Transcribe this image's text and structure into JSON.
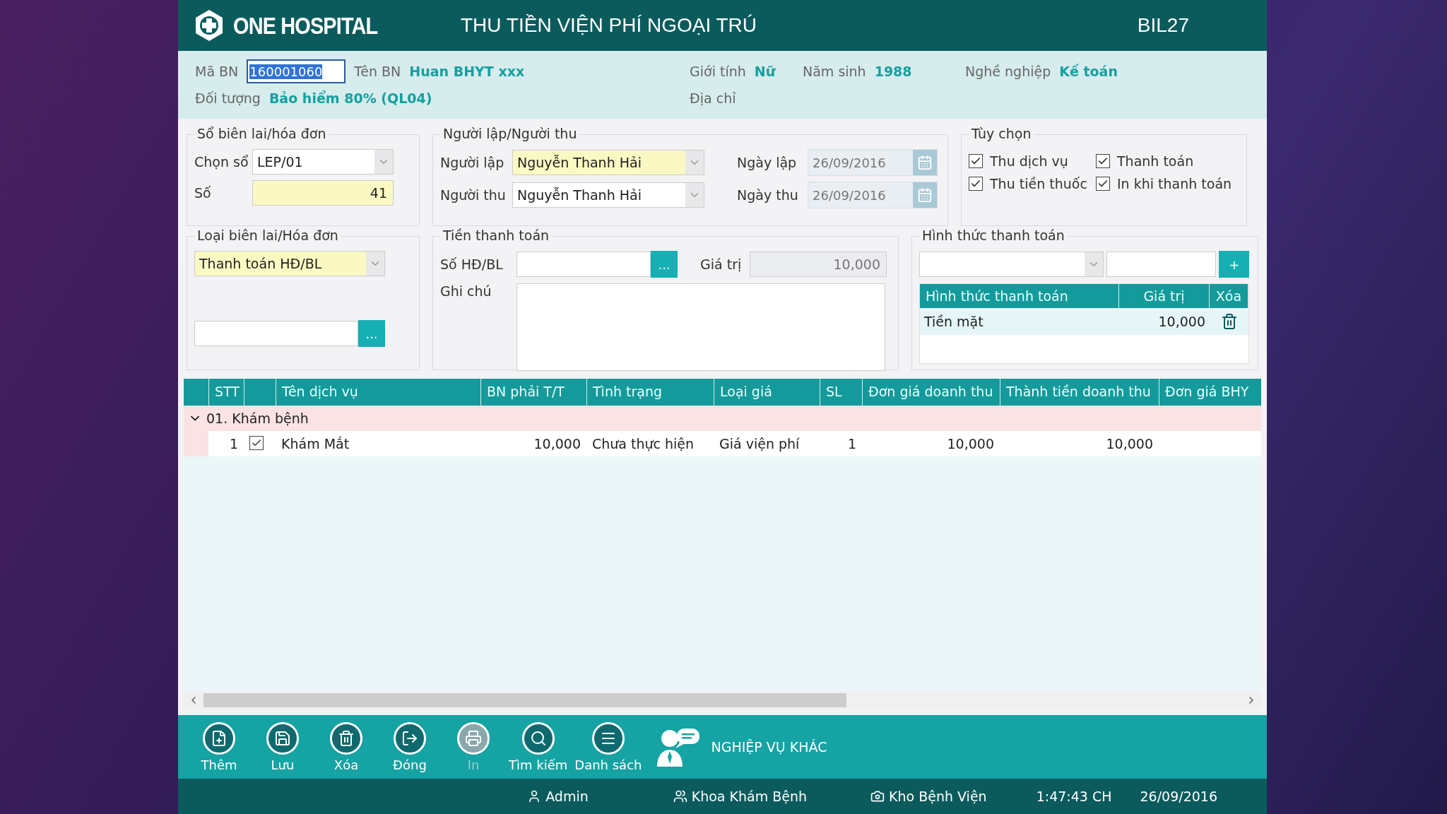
{
  "header": {
    "logo_text": "ONE HOSPITAL",
    "title": "THU TIỀN VIỆN PHÍ NGOẠI TRÚ",
    "code": "BIL27"
  },
  "patient": {
    "ma_bn": {
      "label": "Mã BN",
      "value": "160001060",
      "text_selected": true
    },
    "ten_bn": {
      "label": "Tên BN",
      "value": "Huan BHYT xxx"
    },
    "gioi_tinh": {
      "label": "Giới tính",
      "value": "Nữ"
    },
    "nam_sinh": {
      "label": "Năm sinh",
      "value": "1988"
    },
    "nghe_nghiep": {
      "label": "Nghề nghiệp",
      "value": "Kế toán"
    },
    "doi_tuong": {
      "label": "Đối tượng",
      "value": "Bảo hiểm 80% (QL04)"
    },
    "dia_chi": {
      "label": "Địa chỉ"
    }
  },
  "so_bien_lai": {
    "title": "Sổ biên lai/hóa đơn",
    "chon_so": {
      "label": "Chọn sổ",
      "value": "LEP/01"
    },
    "so": {
      "label": "Số",
      "value": "41"
    }
  },
  "nguoi_lap_thu": {
    "title": "Người lập/Người thu",
    "nguoi_lap": {
      "label": "Người lập",
      "value": "Nguyễn Thanh Hải"
    },
    "nguoi_thu": {
      "label": "Người thu",
      "value": "Nguyễn Thanh Hải"
    },
    "ngay_lap": {
      "label": "Ngày lập",
      "value": "26/09/2016"
    },
    "ngay_thu": {
      "label": "Ngày thu",
      "value": "26/09/2016"
    }
  },
  "tuy_chon": {
    "title": "Tùy chọn",
    "options": [
      {
        "label": "Thu dịch vụ",
        "checked": true
      },
      {
        "label": "Thanh toán",
        "checked": true
      },
      {
        "label": "Thu tiền thuốc",
        "checked": true
      },
      {
        "label": "In khi thanh toán",
        "checked": true
      }
    ]
  },
  "loai_bien_lai": {
    "title": "Loại biên lai/Hóa đơn",
    "value": "Thanh toán HĐ/BL",
    "browse_button": "..."
  },
  "tien_thanh_toan": {
    "title": "Tiền thanh toán",
    "so_hd": {
      "label": "Số HĐ/BL",
      "browse_button": "..."
    },
    "gia_tri": {
      "label": "Giá trị",
      "value": "10,000"
    },
    "ghi_chu": {
      "label": "Ghi chú"
    }
  },
  "hinh_thuc": {
    "title": "Hình thức thanh toán",
    "add_button": "+",
    "columns": [
      "Hình thức thanh toán",
      "Giá trị",
      "Xóa"
    ],
    "rows": [
      {
        "method": "Tiền mặt",
        "value": "10,000"
      }
    ]
  },
  "services": {
    "columns": [
      "STT",
      "",
      "Tên dịch vụ",
      "BN phải T/T",
      "Tình trạng",
      "Loại giá",
      "SL",
      "Đơn giá doanh thu",
      "Thành tiền doanh thu",
      "Đơn giá BHY"
    ],
    "groups": [
      {
        "label": "01. Khám bệnh",
        "expanded": true,
        "rows": [
          {
            "stt": "1",
            "checked": true,
            "name": "Khám Mắt",
            "bn_phai_tt": "10,000",
            "tinh_trang": "Chưa thực hiện",
            "loai_gia": "Giá viện phí",
            "sl": "1",
            "don_gia": "10,000",
            "thanh_tien": "10,000"
          }
        ]
      }
    ]
  },
  "toolbar": {
    "buttons": [
      {
        "kind": "add",
        "label": "Thêm",
        "disabled": false
      },
      {
        "kind": "save",
        "label": "Lưu",
        "disabled": false
      },
      {
        "kind": "delete",
        "label": "Xóa",
        "disabled": false
      },
      {
        "kind": "close",
        "label": "Đóng",
        "disabled": false
      },
      {
        "kind": "print",
        "label": "In",
        "disabled": true
      },
      {
        "kind": "search",
        "label": "Tìm kiếm",
        "disabled": false
      },
      {
        "kind": "list",
        "label": "Danh sách",
        "disabled": false
      }
    ],
    "other": "NGHIỆP VỤ KHÁC"
  },
  "status_bar": [
    {
      "kind": "user",
      "text": "Admin"
    },
    {
      "kind": "department",
      "text": "Khoa Khám Bệnh"
    },
    {
      "kind": "store",
      "text": "Kho Bệnh Viện"
    },
    {
      "kind": "time",
      "text": "1:47:43 CH"
    },
    {
      "kind": "date",
      "text": "26/09/2016"
    }
  ]
}
